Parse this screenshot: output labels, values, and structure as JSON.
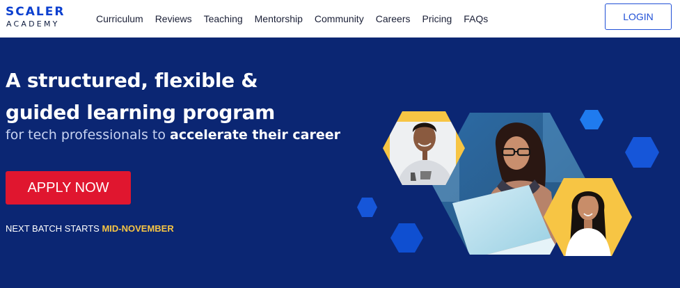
{
  "brand": {
    "name_top": "SCALER",
    "name_bottom": "ACADEMY"
  },
  "nav": {
    "links": [
      "Curriculum",
      "Reviews",
      "Teaching",
      "Mentorship",
      "Community",
      "Careers",
      "Pricing",
      "FAQs"
    ],
    "login_label": "LOGIN"
  },
  "hero": {
    "headline_line1": "A structured, flexible &",
    "headline_line2": "guided learning program",
    "subline_prefix": "for tech professionals to ",
    "subline_emphasis": "accelerate their career",
    "cta_label": "APPLY NOW",
    "batch_prefix": "NEXT BATCH STARTS ",
    "batch_highlight": "MID-NOVEMBER"
  },
  "colors": {
    "primary_blue": "#0b3fcf",
    "hero_background": "#0b2673",
    "cta_red": "#e0162f",
    "accent_yellow": "#f7c544",
    "hexagon_blue": "#1656d9"
  },
  "illustration": {
    "icons": [
      "student-laptop-photo",
      "male-student-avatar",
      "female-student-avatar",
      "hexagon-shape"
    ]
  }
}
